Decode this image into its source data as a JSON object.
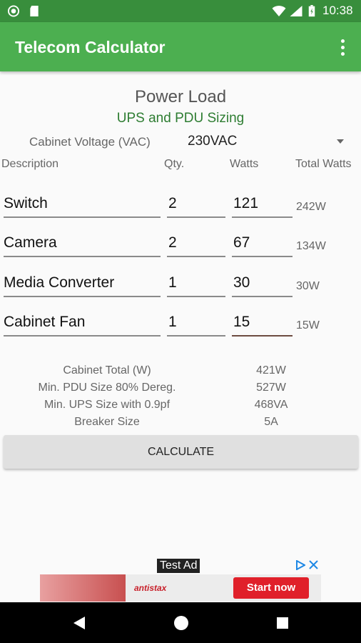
{
  "status_bar": {
    "time": "10:38"
  },
  "app_bar": {
    "title": "Telecom Calculator"
  },
  "header": {
    "title": "Power Load",
    "subtitle": "UPS and PDU Sizing"
  },
  "voltage": {
    "label": "Cabinet Voltage (VAC)",
    "value": "230VAC"
  },
  "columns": {
    "description": "Description",
    "qty": "Qty.",
    "watts": "Watts",
    "total": "Total Watts"
  },
  "rows": [
    {
      "description": "Switch",
      "qty": "2",
      "watts": "121",
      "total": "242W"
    },
    {
      "description": "Camera",
      "qty": "2",
      "watts": "67",
      "total": "134W"
    },
    {
      "description": "Media Converter",
      "qty": "1",
      "watts": "30",
      "total": "30W"
    },
    {
      "description": "Cabinet Fan",
      "qty": "1",
      "watts": "15",
      "total": "15W"
    }
  ],
  "results": [
    {
      "label": "Cabinet Total (W)",
      "value": "421W"
    },
    {
      "label": "Min. PDU Size 80% Dereg.",
      "value": "527W"
    },
    {
      "label": "Min. UPS Size with 0.9pf",
      "value": "468VA"
    },
    {
      "label": "Breaker Size",
      "value": "5A"
    }
  ],
  "button": {
    "label": "CALCULATE"
  },
  "ad": {
    "badge": "Test Ad",
    "brand": "antistax",
    "cta": "Start now"
  },
  "colors": {
    "status_bar": "#388e3c",
    "app_bar": "#4caf50",
    "subtitle": "#2e7d32",
    "ad_cta": "#e0202a"
  }
}
